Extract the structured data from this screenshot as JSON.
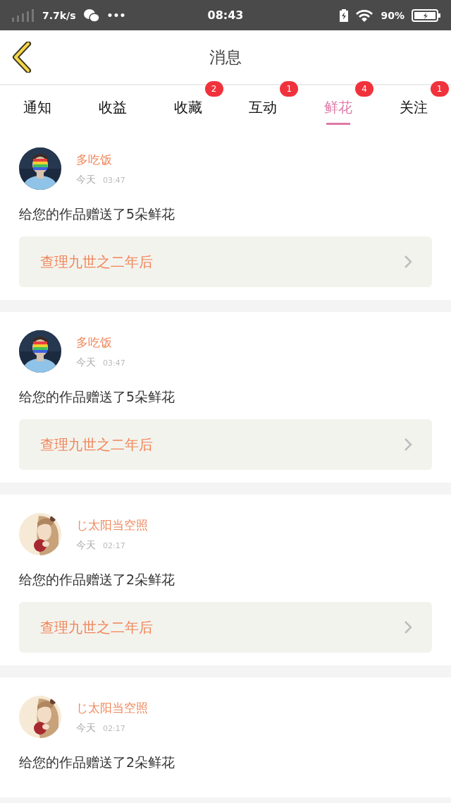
{
  "status_bar": {
    "speed": "7.7k/s",
    "more": "•••",
    "time": "08:43",
    "battery": "90%"
  },
  "header": {
    "title": "消息"
  },
  "tabs": [
    {
      "label": "通知",
      "selected": false
    },
    {
      "label": "收益",
      "selected": false
    },
    {
      "label": "收藏",
      "badge": "2",
      "selected": false
    },
    {
      "label": "互动",
      "badge": "1",
      "selected": false
    },
    {
      "label": "鲜花",
      "badge": "4",
      "selected": true
    },
    {
      "label": "关注",
      "badge": "1",
      "selected": false
    }
  ],
  "messages": [
    {
      "name": "多吃饭",
      "day": "今天",
      "time": "03:47",
      "text": "给您的作品赠送了5朵鲜花",
      "link": "查理九世之二年后"
    },
    {
      "name": "多吃饭",
      "day": "今天",
      "time": "03:47",
      "text": "给您的作品赠送了5朵鲜花",
      "link": "查理九世之二年后"
    },
    {
      "name": "じ太阳当空照",
      "day": "今天",
      "time": "02:17",
      "text": "给您的作品赠送了2朵鲜花",
      "link": "查理九世之二年后"
    },
    {
      "name": "じ太阳当空照",
      "day": "今天",
      "time": "02:17",
      "text": "给您的作品赠送了2朵鲜花"
    }
  ]
}
